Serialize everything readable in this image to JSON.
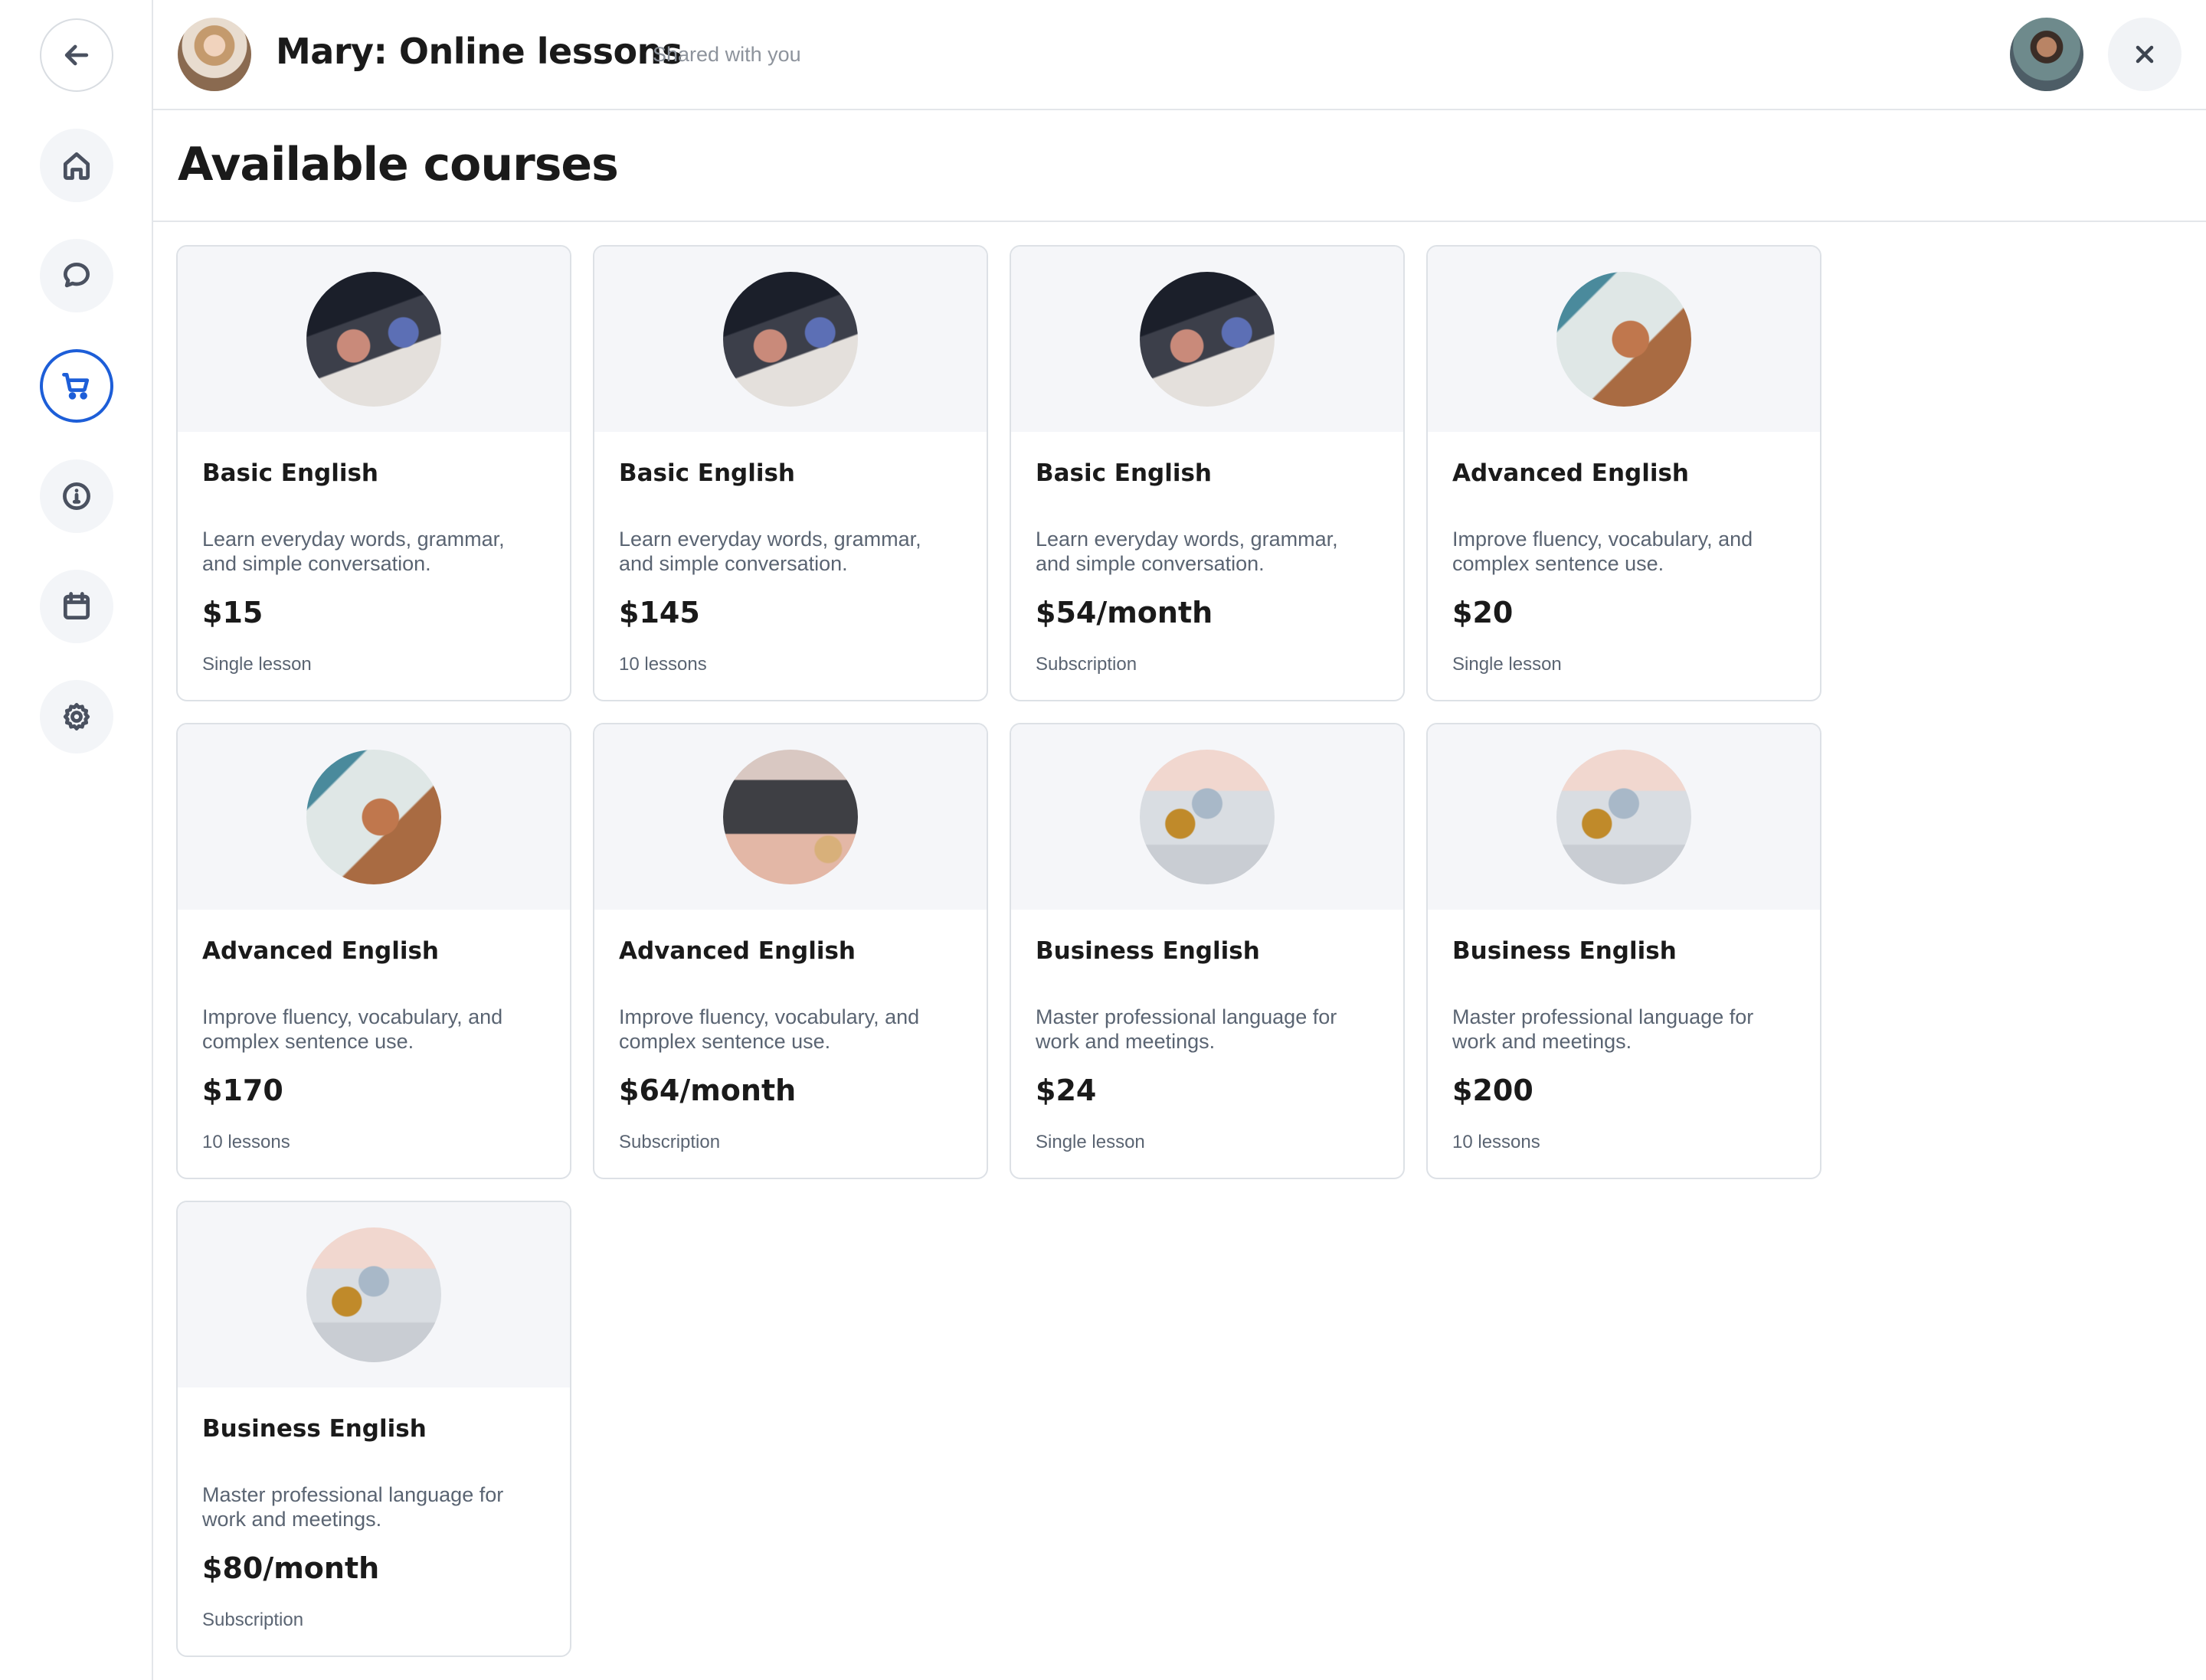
{
  "header": {
    "title": "Mary: Online lessons",
    "shared_label": "Shared with you"
  },
  "section": {
    "title": "Available courses"
  },
  "sidebar": {
    "items": [
      {
        "name": "back",
        "icon": "arrow-left-icon"
      },
      {
        "name": "home",
        "icon": "home-icon"
      },
      {
        "name": "messages",
        "icon": "chat-bubble-icon"
      },
      {
        "name": "shop",
        "icon": "cart-icon",
        "active": true
      },
      {
        "name": "info",
        "icon": "info-icon"
      },
      {
        "name": "calendar",
        "icon": "calendar-icon"
      },
      {
        "name": "settings",
        "icon": "gear-icon"
      }
    ]
  },
  "courses": [
    {
      "title": "Basic English",
      "description": "Learn everyday words, grammar, and simple conversation.",
      "price": "$15",
      "subtitle": "Single lesson",
      "image": "laptop-desk"
    },
    {
      "title": "Basic English",
      "description": "Learn everyday words, grammar, and simple conversation.",
      "price": "$145",
      "subtitle": "10 lessons",
      "image": "laptop-desk"
    },
    {
      "title": "Basic English",
      "description": "Learn everyday words, grammar, and simple conversation.",
      "price": "$54/month",
      "subtitle": "Subscription",
      "image": "laptop-desk"
    },
    {
      "title": "Advanced English",
      "description": "Improve fluency, vocabulary, and complex sentence use.",
      "price": "$20",
      "subtitle": "Single lesson",
      "image": "writing"
    },
    {
      "title": "Advanced English",
      "description": "Improve fluency, vocabulary, and complex sentence use.",
      "price": "$170",
      "subtitle": "10 lessons",
      "image": "writing"
    },
    {
      "title": "Advanced English",
      "description": "Improve fluency, vocabulary, and complex sentence use.",
      "price": "$64/month",
      "subtitle": "Subscription",
      "image": "keyboard"
    },
    {
      "title": "Business English",
      "description": "Master professional language for work and meetings.",
      "price": "$24",
      "subtitle": "Single lesson",
      "image": "office"
    },
    {
      "title": "Business English",
      "description": "Master professional language for work and meetings.",
      "price": "$200",
      "subtitle": "10 lessons",
      "image": "office"
    },
    {
      "title": "Business English",
      "description": "Master professional language for work and meetings.",
      "price": "$80/month",
      "subtitle": "Subscription",
      "image": "office"
    }
  ],
  "colors": {
    "accent": "#1d5ed8",
    "card_top_bg": "#f5f6f9",
    "border": "#dde1e6"
  }
}
